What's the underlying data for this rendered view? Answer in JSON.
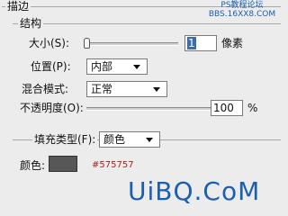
{
  "dialog": {
    "section_title": "描边",
    "structure": {
      "group_label": "结构",
      "size": {
        "label": "大小(S):",
        "value": "1",
        "unit": "像素",
        "slider_fraction": 0.0
      },
      "position": {
        "label": "位置(P):",
        "value": "内部"
      },
      "blend_mode": {
        "label": "混合模式:",
        "value": "正常"
      },
      "opacity": {
        "label": "不透明度(O):",
        "value": "100",
        "unit": "%",
        "slider_fraction": 1.0
      }
    },
    "fill": {
      "type_label": "填充类型(F):",
      "type_value": "颜色",
      "color_label": "颜色:",
      "color_hex": "#575757",
      "color_value_text": "#575757"
    }
  },
  "watermarks": {
    "top": "PS教程论坛\nBBS.16XX8.COM",
    "bottom": "UiBQ.CoM"
  },
  "colors": {
    "watermark_blue": "#1a5fb0",
    "hex_text_red": "#b0201a",
    "selection_blue": "#3a6ea5"
  }
}
